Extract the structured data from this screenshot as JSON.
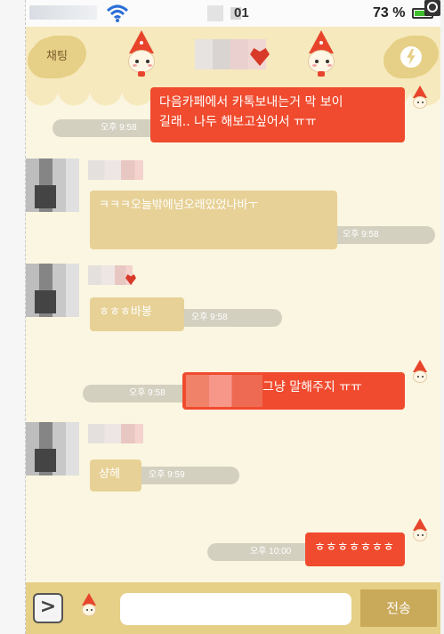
{
  "status_bar": {
    "time_suffix": "01",
    "battery": "73 %"
  },
  "header": {
    "chat_label": "채팅"
  },
  "messages": [
    {
      "id": 1,
      "side": "right",
      "text": "다음카페에서 카톡보내는거 막 보이\n길래.. 나두 해보고싶어서 ㅠㅠ",
      "time": "오후 9:58"
    },
    {
      "id": 2,
      "side": "left",
      "text": "ㅋㅋㅋ오늘밖에넘오래있었나바ㅜ",
      "time": "오후 9:58"
    },
    {
      "id": 3,
      "side": "left",
      "text": "ㅎㅎㅎ바봉",
      "time": "오후 9:58"
    },
    {
      "id": 4,
      "side": "right",
      "text": "그냥 말해주지 ㅠㅠ",
      "time": "오후 9:58"
    },
    {
      "id": 5,
      "side": "left",
      "text": "샹헤",
      "time": "오후 9:59"
    },
    {
      "id": 6,
      "side": "right",
      "text": "ㅎㅎㅎㅎㅎㅎㅎ",
      "time": "오후 10:00"
    }
  ],
  "input_bar": {
    "placeholder": "",
    "send_label": "전송",
    "more_glyph": ">"
  },
  "colors": {
    "my_bubble": "#f04b2e",
    "friend_bubble": "#e7d196",
    "background": "#fbf6e1",
    "header": "#f6e9bd"
  },
  "icons": [
    "wifi-icon",
    "battery-icon",
    "strawberry-character-icon",
    "bolt-icon",
    "chevron-right-icon"
  ]
}
